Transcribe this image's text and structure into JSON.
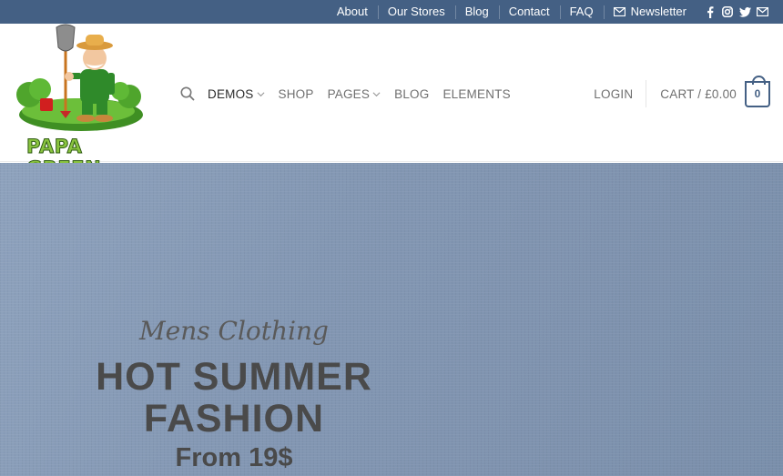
{
  "topbar": {
    "links": [
      "About",
      "Our Stores",
      "Blog",
      "Contact",
      "FAQ"
    ],
    "newsletter": "Newsletter",
    "social_icons": [
      "facebook-icon",
      "instagram-icon",
      "twitter-icon",
      "email-icon"
    ],
    "bg_color": "#446084"
  },
  "logo": {
    "text": "PAPA GREEN"
  },
  "nav": {
    "items": [
      {
        "label": "DEMOS",
        "dropdown": true,
        "active": true
      },
      {
        "label": "SHOP",
        "dropdown": false
      },
      {
        "label": "PAGES",
        "dropdown": true
      },
      {
        "label": "BLOG",
        "dropdown": false
      },
      {
        "label": "ELEMENTS",
        "dropdown": false
      }
    ],
    "login": "LOGIN",
    "cart": "CART / £0.00",
    "cart_count": "0",
    "accent_color": "#446084"
  },
  "hero": {
    "subtitle": "Mens Clothing",
    "title_line1": "HOT SUMMER",
    "title_line2": "FASHION",
    "price": "From 19$"
  }
}
